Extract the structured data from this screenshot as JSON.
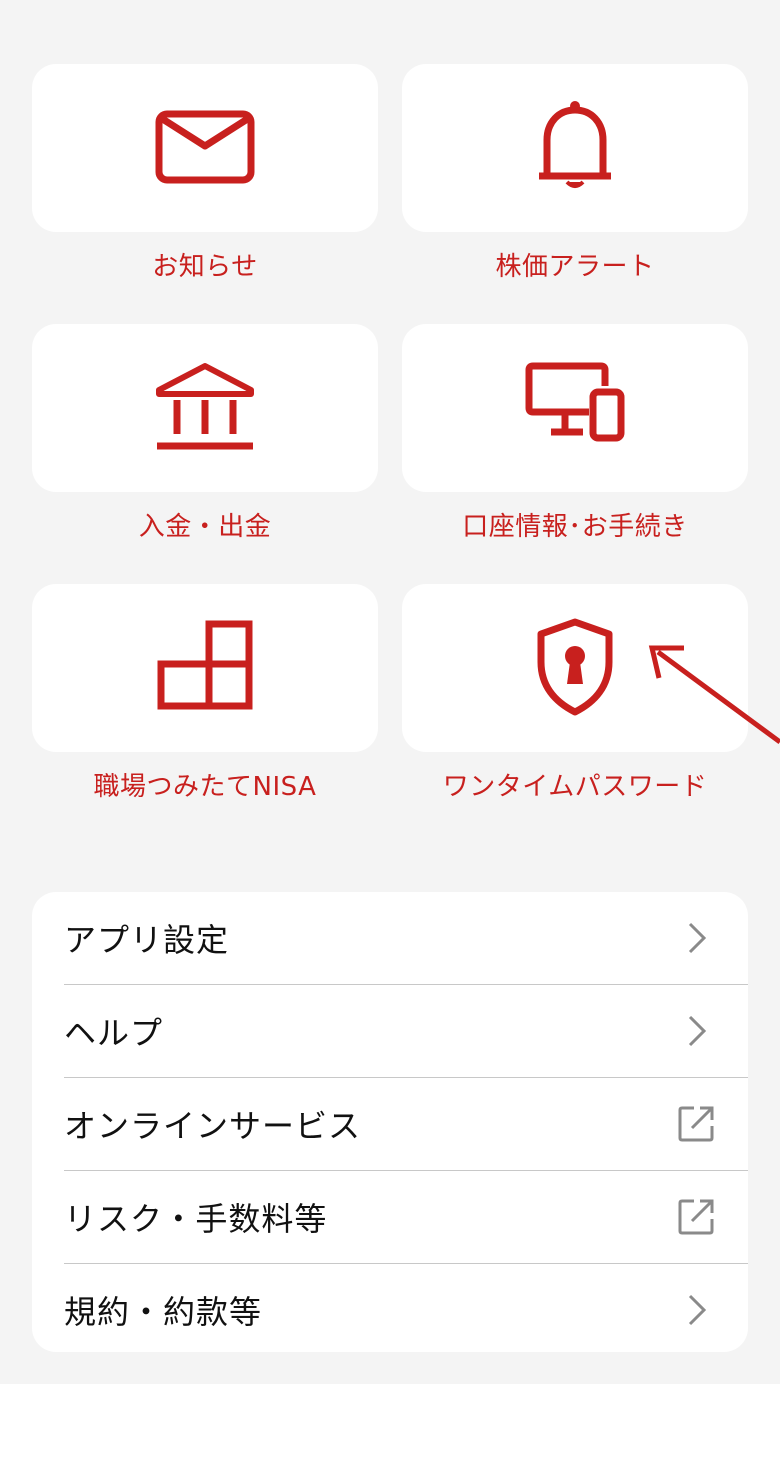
{
  "accent_color": "#c8201e",
  "tiles": [
    {
      "label": "お知らせ",
      "icon": "envelope-icon"
    },
    {
      "label": "株価アラート",
      "icon": "bell-icon"
    },
    {
      "label": "入金・出金",
      "icon": "bank-icon"
    },
    {
      "label": "口座情報･お手続き",
      "icon": "devices-icon"
    },
    {
      "label": "職場つみたてNISA",
      "icon": "blocks-icon"
    },
    {
      "label": "ワンタイムパスワード",
      "icon": "shield-keyhole-icon"
    }
  ],
  "menu": [
    {
      "label": "アプリ設定",
      "icon": "chevron-right-icon"
    },
    {
      "label": "ヘルプ",
      "icon": "chevron-right-icon"
    },
    {
      "label": "オンラインサービス",
      "icon": "external-link-icon"
    },
    {
      "label": "リスク・手数料等",
      "icon": "external-link-icon"
    },
    {
      "label": "規約・約款等",
      "icon": "chevron-right-icon"
    }
  ]
}
